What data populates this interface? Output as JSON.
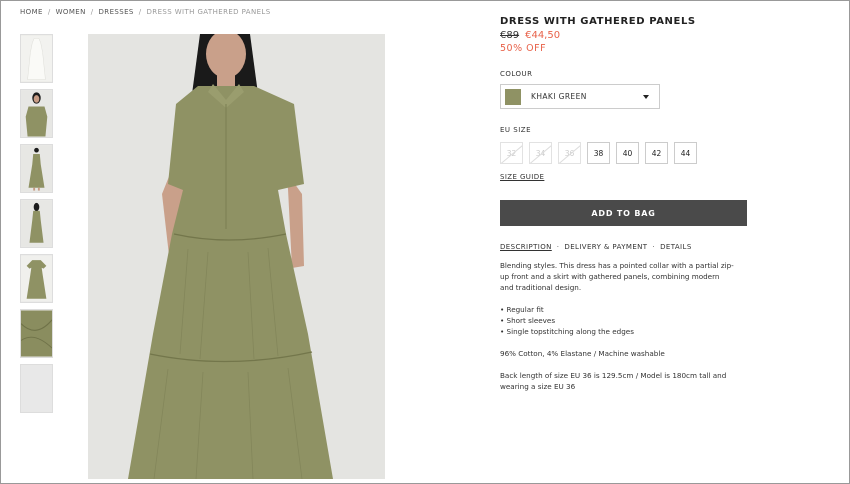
{
  "breadcrumb": [
    "HOME",
    "WOMEN",
    "DRESSES",
    "DRESS WITH GATHERED PANELS"
  ],
  "breadcrumb_separator": "/",
  "product": {
    "title": "DRESS WITH GATHERED PANELS",
    "old_price": "€89",
    "new_price": "€44,50",
    "discount": "50% OFF"
  },
  "colour": {
    "label": "COLOUR",
    "selected": "KHAKI GREEN",
    "swatch_color": "#8f9264"
  },
  "size": {
    "label": "EU SIZE",
    "options": [
      {
        "label": "32",
        "available": false
      },
      {
        "label": "34",
        "available": false
      },
      {
        "label": "36",
        "available": false
      },
      {
        "label": "38",
        "available": true
      },
      {
        "label": "40",
        "available": true
      },
      {
        "label": "42",
        "available": true
      },
      {
        "label": "44",
        "available": true
      }
    ],
    "guide_label": "SIZE GUIDE"
  },
  "add_to_bag_label": "ADD TO BAG",
  "tabs": {
    "items": [
      "DESCRIPTION",
      "DELIVERY & PAYMENT",
      "DETAILS"
    ],
    "separator": "·",
    "active_index": 0
  },
  "description": {
    "intro": "Blending styles. This dress has a pointed collar with a partial zip-up front and a skirt with gathered panels, combining modern and traditional design.",
    "bullets": [
      "• Regular fit",
      "• Short sleeves",
      "• Single topstitching along the edges"
    ],
    "composition": "96% Cotton, 4% Elastane / Machine washable",
    "measurements": "Back length of size EU 36 is 129.5cm / Model is 180cm tall and wearing a size EU 36"
  },
  "colors": {
    "sale": "#e8624a",
    "button_bg": "#4a4a4a",
    "dress": "#8f9264"
  }
}
